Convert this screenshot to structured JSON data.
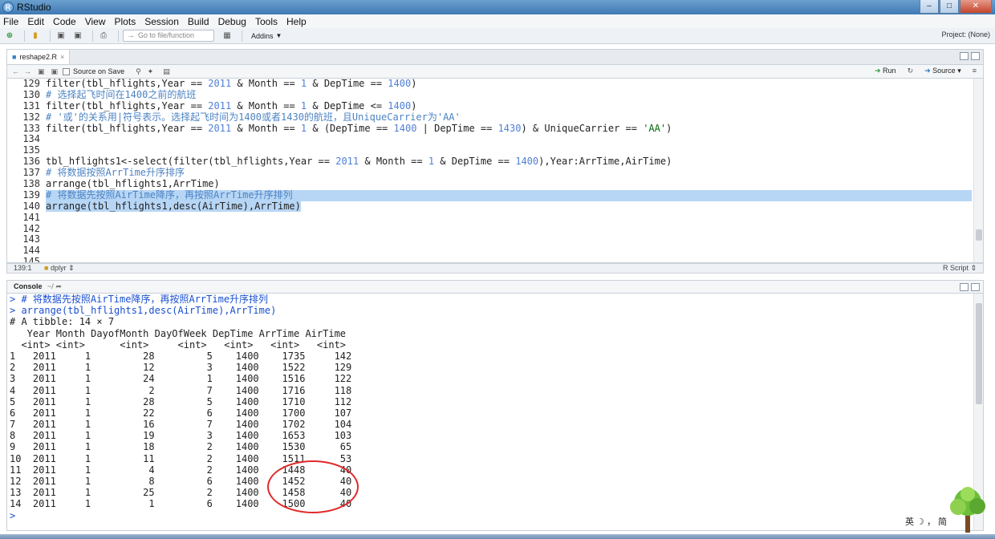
{
  "window": {
    "title": "RStudio"
  },
  "menu": [
    "File",
    "Edit",
    "Code",
    "View",
    "Plots",
    "Session",
    "Build",
    "Debug",
    "Tools",
    "Help"
  ],
  "toolbar": {
    "goto_placeholder": "Go to file/function",
    "addins": "Addins",
    "project": "Project: (None)"
  },
  "editor": {
    "tab": "reshape2.R",
    "source_on_save": "Source on Save",
    "run": "Run",
    "source": "Source",
    "line_numbers": [
      "129",
      "130",
      "131",
      "132",
      "133",
      "134",
      "135",
      "136",
      "137",
      "138",
      "139",
      "140",
      "141",
      "142",
      "143",
      "144",
      "145"
    ],
    "status_pos": "139:1",
    "scope": "dplyr",
    "file_type": "R Script"
  },
  "console": {
    "title": "Console",
    "path": "~/",
    "lines": [
      "> # 将数据先按照AirTime降序，再按照ArrTime升序排列",
      "> arrange(tbl_hflights1,desc(AirTime),ArrTime)",
      "# A tibble: 14 × 7",
      "   Year Month DayofMonth DayOfWeek DepTime ArrTime AirTime",
      "  <int> <int>      <int>     <int>   <int>   <int>   <int>",
      "1   2011     1         28         5    1400    1735     142",
      "2   2011     1         12         3    1400    1522     129",
      "3   2011     1         24         1    1400    1516     122",
      "4   2011     1          2         7    1400    1716     118",
      "5   2011     1         28         5    1400    1710     112",
      "6   2011     1         22         6    1400    1700     107",
      "7   2011     1         16         7    1400    1702     104",
      "8   2011     1         19         3    1400    1653     103",
      "9   2011     1         18         2    1400    1530      65",
      "10  2011     1         11         2    1400    1511      53",
      "11  2011     1          4         2    1400    1448      40",
      "12  2011     1          8         6    1400    1452      40",
      "13  2011     1         25         2    1400    1458      40",
      "14  2011     1          1         6    1400    1500      40",
      ">"
    ]
  },
  "ime": "英 ☽ ， 简"
}
